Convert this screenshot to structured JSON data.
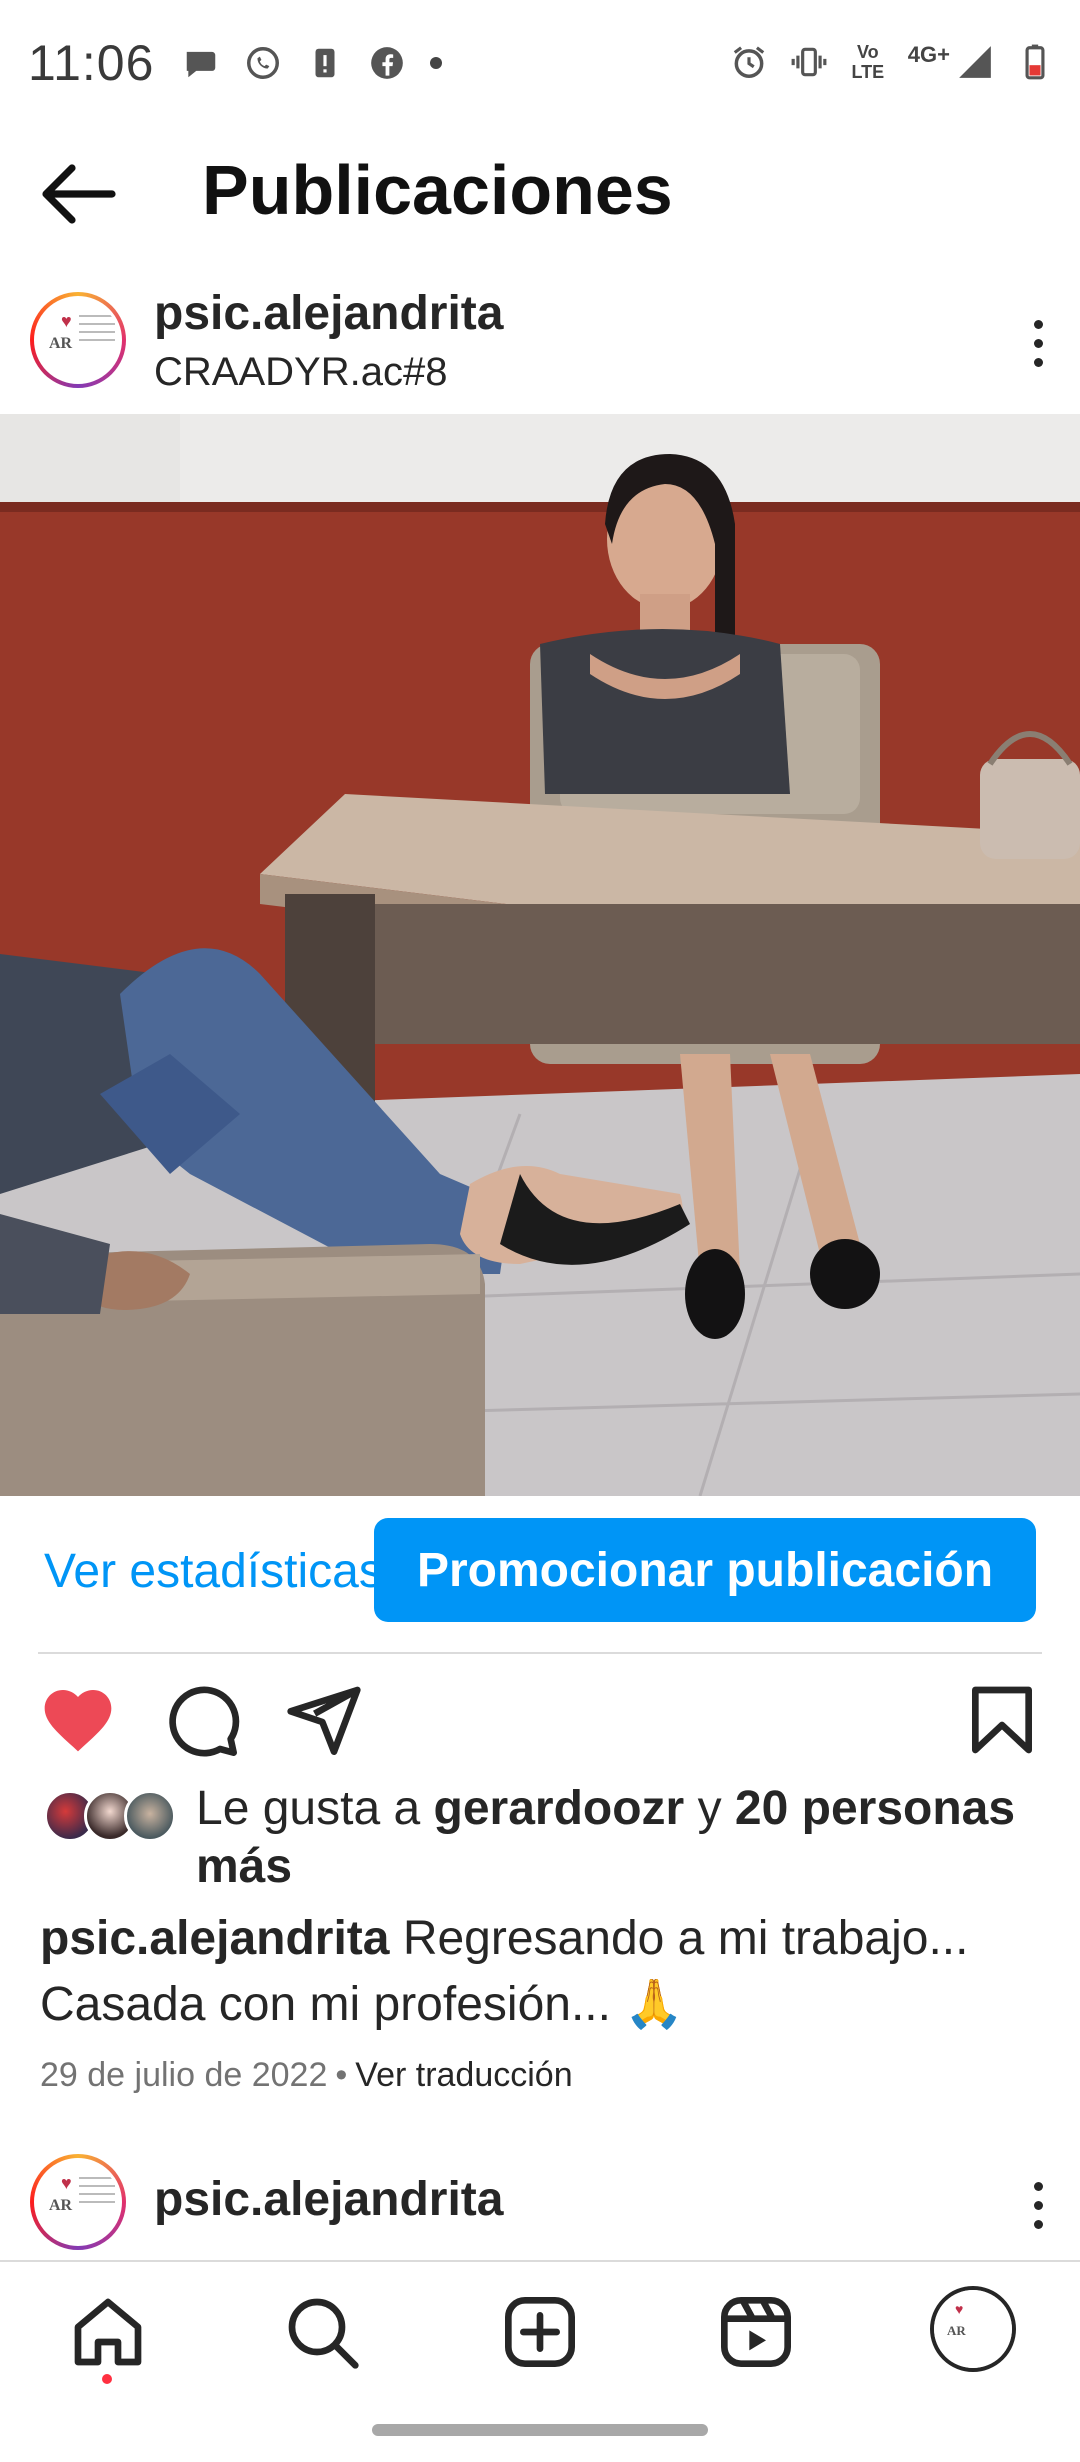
{
  "status_bar": {
    "time": "11:06",
    "network": "4G+",
    "volte": "Vo LTE",
    "left_icons": [
      "chat-bubble-icon",
      "whatsapp-icon",
      "alert-icon",
      "facebook-icon",
      "dot-icon"
    ],
    "right_icons": [
      "alarm-icon",
      "vibrate-icon",
      "volte-icon",
      "signal-icon",
      "battery-icon"
    ]
  },
  "header": {
    "title": "Publicaciones",
    "back_icon": "arrow-left-icon"
  },
  "post": {
    "username": "psic.alejandrita",
    "location": "CRAADYR.ac#8",
    "avatar_text": "AR",
    "insights_label": "Ver estadísticas",
    "promote_label": "Promocionar publicación",
    "liked": true,
    "likes": {
      "prefix": "Le gusta a ",
      "user": "gerardoozr",
      "connector": " y ",
      "others": "20 personas más"
    },
    "caption": {
      "username": "psic.alejandrita",
      "text_line1": " Regresando a mi trabajo...",
      "text_line2": "Casada con mi profesión... ",
      "emoji": "🙏"
    },
    "date": "29 de julio de 2022",
    "separator": "•",
    "translate_label": "Ver traducción"
  },
  "next_post": {
    "username": "psic.alejandrita"
  },
  "colors": {
    "accent_blue": "#0095f6",
    "like_red": "#ed4956",
    "text": "#262626",
    "muted": "#737373"
  },
  "bottom_nav": {
    "items": [
      "home-icon",
      "search-icon",
      "create-icon",
      "reels-icon",
      "profile-avatar"
    ]
  }
}
